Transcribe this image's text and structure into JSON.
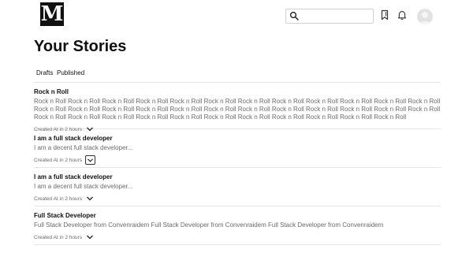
{
  "header": {
    "logo_letter": "M",
    "search_placeholder": "",
    "icons": [
      "search-icon",
      "bookmark-icon",
      "bell-icon",
      "avatar"
    ]
  },
  "page": {
    "title": "Your Stories"
  },
  "tabs": [
    {
      "label": "Drafts",
      "active": true
    },
    {
      "label": "Published",
      "active": false
    }
  ],
  "stories": [
    {
      "title": "Rock n Roll",
      "body": "Rock n Roll Rock n Roll Rock n Roll Rock n Roll Rock n Roll Rock n Roll Rock n Roll Rock n Roll Rock n Roll Rock n Roll Rock n Roll Rock n Roll Rock n Roll Rock n Roll Rock n Roll Rock n Roll Rock n Roll Rock n Roll Rock n Roll Rock n Roll Rock n Roll Rock n Roll Rock n Roll Rock n Roll Rock n Roll Rock n Roll Rock n Roll Rock n Roll Rock n Roll Rock n Roll Rock n Roll Rock n Roll Rock n Roll Rock n Roll Rock n Roll",
      "meta": "Created At in 2 hours"
    },
    {
      "title": "I am a full stack developer",
      "body": "I am a decent full stack developer...",
      "meta": "Created At in 2 hours"
    },
    {
      "title": "I am a full stack developer",
      "body": "I am a decent full stack developer...",
      "meta": "Created At in 2 hours"
    },
    {
      "title": "Full Stack Developer",
      "body": "Full Stack Developer from Convenraidem Full Stack Developer from Convenraidem Full Stack Developer from Convenraidem",
      "meta": "Created At in 2 hours"
    }
  ]
}
